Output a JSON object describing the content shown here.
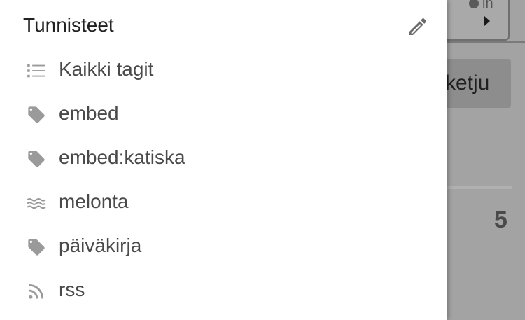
{
  "colors": {
    "drawer_bg": "#ffffff",
    "overlay": "#a3a3a3",
    "icon_gray": "#9a9a9a",
    "label_text": "#4a4a4a",
    "title_text": "#222222"
  },
  "background": {
    "top_button_text": "in",
    "chip_text": "ketju",
    "count": "5"
  },
  "drawer": {
    "title": "Tunnisteet",
    "edit_icon": "pencil-icon",
    "items": [
      {
        "label": "Kaikki tagit",
        "icon": "list-icon"
      },
      {
        "label": "embed",
        "icon": "tag-icon"
      },
      {
        "label": "embed:katiska",
        "icon": "tag-icon"
      },
      {
        "label": "melonta",
        "icon": "waves-icon"
      },
      {
        "label": "päiväkirja",
        "icon": "tag-icon"
      },
      {
        "label": "rss",
        "icon": "rss-icon"
      }
    ]
  }
}
